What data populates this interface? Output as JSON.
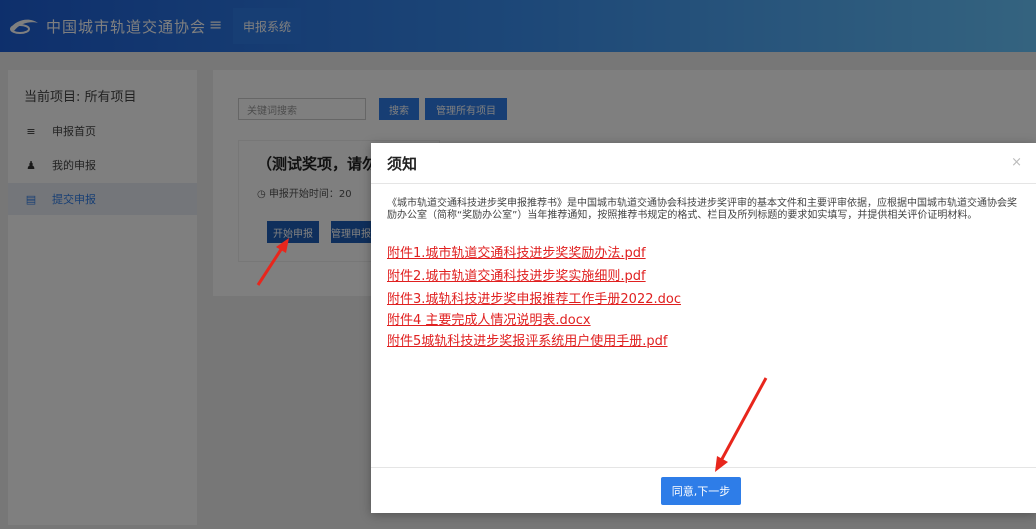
{
  "header": {
    "brand": "中国城市轨道交通协会",
    "system_tab": "申报系统"
  },
  "sidebar": {
    "project_title": "当前项目: 所有项目",
    "items": [
      {
        "label": "申报首页"
      },
      {
        "label": "我的申报"
      },
      {
        "label": "提交申报"
      }
    ]
  },
  "content": {
    "search_placeholder": "关键词搜索",
    "search_button": "搜索",
    "manage_all_button": "管理所有项目",
    "card": {
      "title": "（测试奖项，请勿",
      "time_label": "申报开始时间：20",
      "start_button": "开始申报",
      "manage_button": "管理申报"
    }
  },
  "modal": {
    "title": "须知",
    "close": "×",
    "notice": "《城市轨道交通科技进步奖申报推荐书》是中国城市轨道交通协会科技进步奖评审的基本文件和主要评审依据，应根据中国城市轨道交通协会奖励办公室（简称“奖励办公室”）当年推荐通知，按照推荐书规定的格式、栏目及所列标题的要求如实填写，并提供相关评价证明材料。",
    "attachments": [
      "附件1.城市轨道交通科技进步奖奖励办法.pdf",
      "附件2.城市轨道交通科技进步奖实施细则.pdf",
      "附件3.城轨科技进步奖申报推荐工作手册2022.doc",
      "附件4 主要完成人情况说明表.docx",
      "附件5城轨科技进步奖报评系统用户使用手册.pdf"
    ],
    "agree_button": "同意,下一步"
  },
  "colors": {
    "accent": "#2e7de8",
    "link_red": "#e02020",
    "arrow_red": "#e8261c"
  }
}
